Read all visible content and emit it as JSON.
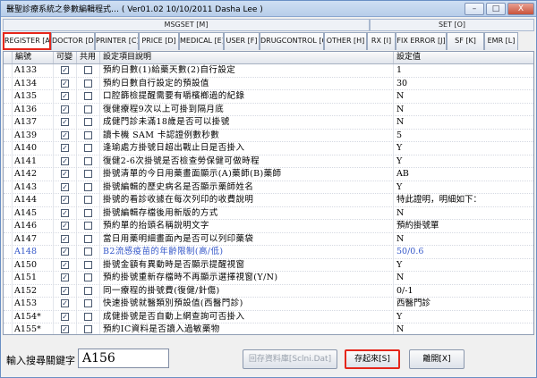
{
  "window": {
    "title": "醫聖診療系統之參數編輯程式… ( Ver01.02 10/10/2011 Dasha Lee )",
    "minimize": "–",
    "maximize": "□",
    "close": "X"
  },
  "groups": [
    {
      "label": "MSGSET [M]"
    },
    {
      "label": "SET [O]"
    }
  ],
  "tabs": [
    {
      "label": "REGISTER [A]",
      "active": true
    },
    {
      "label": "DOCTOR [D]"
    },
    {
      "label": "PRINTER [C]"
    },
    {
      "label": "PRICE [D]"
    },
    {
      "label": "MEDICAL [E]"
    },
    {
      "label": "USER [F]"
    },
    {
      "label": "DRUGCONTROL [G]"
    },
    {
      "label": "OTHER [H]"
    },
    {
      "label": "RX [I]"
    },
    {
      "label": "FIX ERROR [J]"
    },
    {
      "label": "SF [K]"
    },
    {
      "label": "EMR [L]"
    }
  ],
  "grid": {
    "headers": {
      "code": "編號",
      "editable": "可變",
      "shared": "共用",
      "desc": "設定項目說明",
      "value": "設定值"
    },
    "rows": [
      {
        "code": "A133",
        "editable": true,
        "shared": false,
        "desc": "預約日數(1)給藥天數(2)自行設定",
        "value": "1"
      },
      {
        "code": "A134",
        "editable": true,
        "shared": false,
        "desc": "預約日數自行設定的預設值",
        "value": "30"
      },
      {
        "code": "A135",
        "editable": true,
        "shared": false,
        "desc": "口腔篩檢提醒需要有嚼檳榔過的紀錄",
        "value": "N"
      },
      {
        "code": "A136",
        "editable": true,
        "shared": false,
        "desc": "復健療程9次以上可掛到隔月底",
        "value": "N"
      },
      {
        "code": "A137",
        "editable": true,
        "shared": false,
        "desc": "成健門診未滿18歲是否可以掛號",
        "value": "N"
      },
      {
        "code": "A139",
        "editable": true,
        "shared": false,
        "desc": "讀卡機 SAM 卡認證例數秒數",
        "value": "5"
      },
      {
        "code": "A140",
        "editable": true,
        "shared": false,
        "desc": "逢瑜處方掛號日超出戰止日是否掛入",
        "value": "Y"
      },
      {
        "code": "A141",
        "editable": true,
        "shared": false,
        "desc": "復健2-6次掛號是否檢查勞保健可做時程",
        "value": "Y"
      },
      {
        "code": "A142",
        "editable": true,
        "shared": false,
        "desc": "掛號清單的今日用藥畫面顯示(A)藥師(B)藥師",
        "value": "AB"
      },
      {
        "code": "A143",
        "editable": true,
        "shared": false,
        "desc": "掛號編輯的歷史病名是否顯示藥師姓名",
        "value": "Y"
      },
      {
        "code": "A144",
        "editable": true,
        "shared": false,
        "desc": "掛號的看診收據在每次列印的收費說明",
        "value": "特此證明，明細如下："
      },
      {
        "code": "A145",
        "editable": true,
        "shared": false,
        "desc": "掛號編輯存檔後用新版的方式",
        "value": "N"
      },
      {
        "code": "A146",
        "editable": true,
        "shared": false,
        "desc": "預約單的抬頭名稱說明文字",
        "value": "預約掛號單"
      },
      {
        "code": "A147",
        "editable": true,
        "shared": false,
        "desc": "當日用藥明細畫面內是否可以列印藥袋",
        "value": "N"
      },
      {
        "code": "A148",
        "editable": true,
        "shared": false,
        "desc": "B2流感疫苗的年齡限制(高/低)",
        "value": "50/0.6",
        "blue": true
      },
      {
        "code": "A150",
        "editable": true,
        "shared": false,
        "desc": "掛號金額有異動時是否顯示提醒視窗",
        "value": "Y"
      },
      {
        "code": "A151",
        "editable": true,
        "shared": false,
        "desc": "預約掛號重新存檔時不再顯示選擇視窗(Y/N)",
        "value": "N"
      },
      {
        "code": "A152",
        "editable": true,
        "shared": false,
        "desc": "同一療程的掛號費(復健/針傷)",
        "value": "0/-1"
      },
      {
        "code": "A153",
        "editable": true,
        "shared": false,
        "desc": "快速掛號就醫類別預設值(西醫門診)",
        "value": "西醫門診"
      },
      {
        "code": "A154*",
        "editable": true,
        "shared": false,
        "desc": "成健掛號是否自動上網查詢可否掛入",
        "value": "Y"
      },
      {
        "code": "A155*",
        "editable": true,
        "shared": false,
        "desc": "預約IC資料是否讀入過敏藥物",
        "value": "N"
      },
      {
        "code": "A156*",
        "editable": true,
        "shared": false,
        "desc": "預約掛號自定序號",
        "value": "1,3,5,7,9,11,13,15,17,19",
        "current": true
      }
    ]
  },
  "bottom": {
    "search_label": "輸入搜尋關鍵字",
    "search_value": "A156",
    "save_ini_label": "回存資料庫[Sclni.Dat]",
    "save_label": "存起來[S]",
    "exit_label": "離開[X]"
  },
  "colors": {
    "highlight_border": "#e5261b",
    "current_value_bg": "#fff200",
    "blue_row_text": "#3457c9"
  }
}
